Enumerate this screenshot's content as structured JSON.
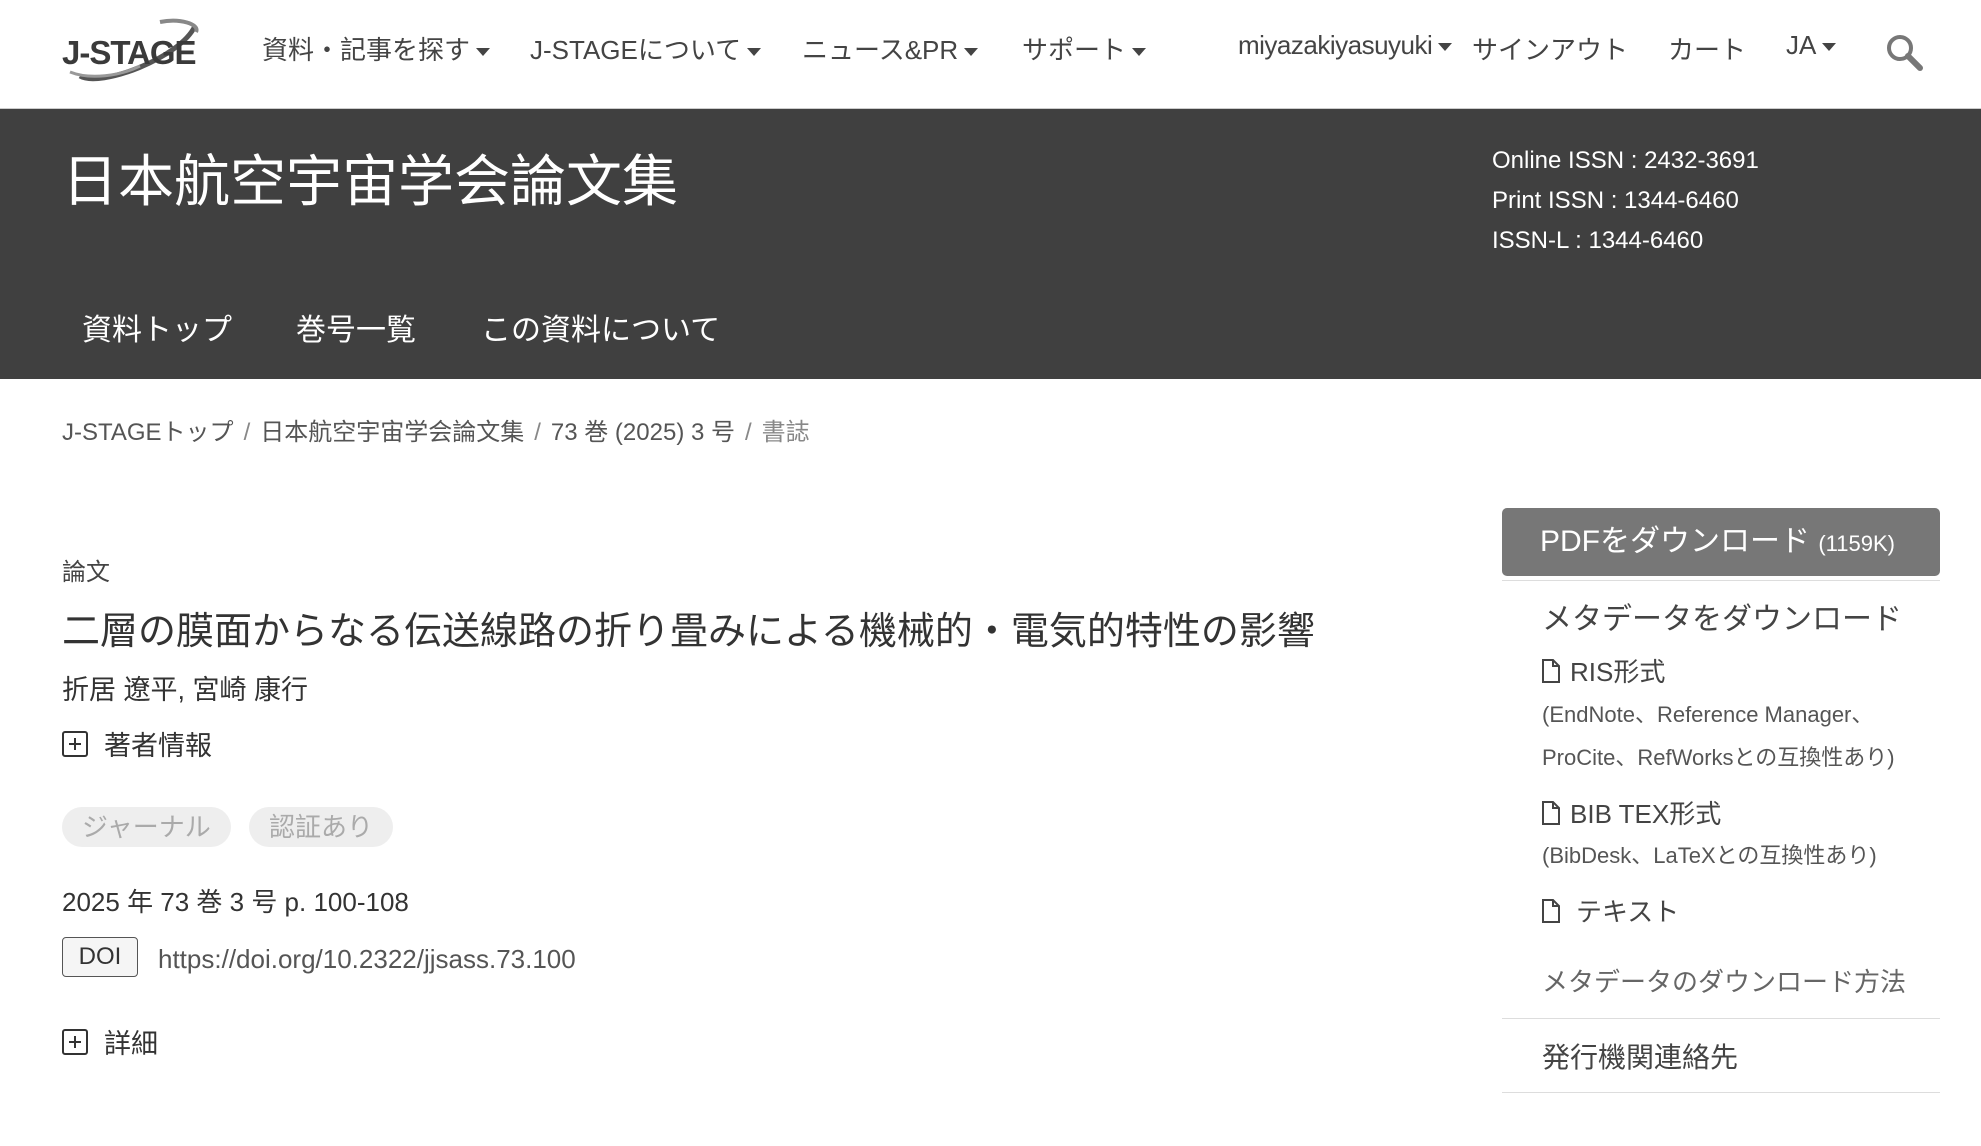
{
  "logo": {
    "text": "J-STAGE"
  },
  "topnav": {
    "search_articles": "資料・記事を探す",
    "about": "J-STAGEについて",
    "news": "ニュース&PR",
    "support": "サポート",
    "user": "miyazakiyasuyuki",
    "signout": "サインアウト",
    "cart": "カート",
    "lang": "JA"
  },
  "journal": {
    "title": "日本航空宇宙学会論文集",
    "online_issn": "Online ISSN : 2432-3691",
    "print_issn": "Print ISSN : 1344-6460",
    "issn_l": "ISSN-L : 1344-6460",
    "nav": [
      "資料トップ",
      "巻号一覧",
      "この資料について"
    ]
  },
  "breadcrumb": [
    "J-STAGEトップ",
    "日本航空宇宙学会論文集",
    "73 巻 (2025) 3 号",
    "書誌"
  ],
  "article": {
    "category": "論文",
    "title": "二層の膜面からなる伝送線路の折り畳みによる機械的・電気的特性の影響",
    "authors": "折居 遼平, 宮崎 康行",
    "author_info": "著者情報",
    "tags": [
      "ジャーナル",
      "認証あり"
    ],
    "volume": "2025 年 73 巻 3 号 p. 100-108",
    "doi_label": "DOI",
    "doi_url": "https://doi.org/10.2322/jjsass.73.100",
    "details": "詳細"
  },
  "sidebar": {
    "pdf_label": "PDFをダウンロード",
    "pdf_size": "(1159K)",
    "metadata_heading": "メタデータをダウンロード",
    "ris": "RIS形式",
    "ris_note1": "(EndNote、Reference Manager、",
    "ris_note2": "ProCite、RefWorksとの互換性あり)",
    "bib": "BIB TEX形式",
    "bib_note": "(BibDesk、LaTeXとの互換性あり)",
    "text": "テキスト",
    "how_to": "メタデータのダウンロード方法",
    "publisher_contact": "発行機関連絡先"
  }
}
